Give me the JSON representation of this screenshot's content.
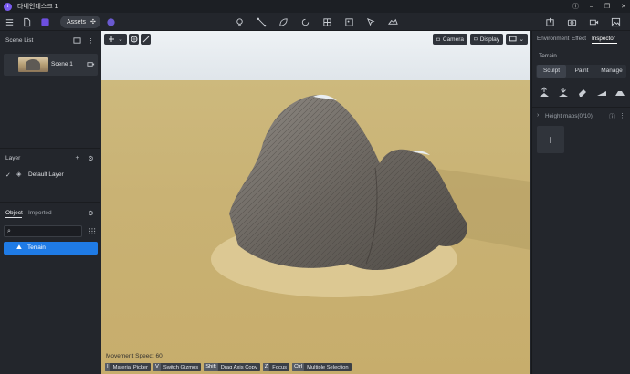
{
  "titlebar": {
    "app_title": "타네인데스크 1",
    "logo_letter": "t"
  },
  "toolbar": {
    "assets_label": "Assets"
  },
  "left": {
    "scene_list_title": "Scene List",
    "scene_name": "Scene 1",
    "layer_title": "Layer",
    "default_layer": "Default Layer",
    "object_tab": "Object",
    "imported_tab": "Imported",
    "terrain_item": "Terrain"
  },
  "viewport": {
    "camera_label": "Camera",
    "display_label": "Display",
    "movement_speed": "Movement Speed: 60",
    "hints": [
      {
        "key": "I",
        "label": "Material Picker"
      },
      {
        "key": "V",
        "label": "Switch Gizmos"
      },
      {
        "key": "Shift",
        "label": "Drag Axis Copy"
      },
      {
        "key": "Z",
        "label": "Focus"
      },
      {
        "key": "Ctrl",
        "label": "Multiple Selection"
      }
    ]
  },
  "right": {
    "tabs": [
      "Environment",
      "Effect",
      "Inspector"
    ],
    "active_tab": "Inspector",
    "section_title": "Terrain",
    "segments": [
      "Sculpt",
      "Paint",
      "Manage"
    ],
    "active_segment": "Sculpt",
    "height_maps_label": "Height maps(0/10)",
    "add_symbol": "+"
  },
  "colors": {
    "accent": "#1f7be6",
    "logo": "#7a5cf0",
    "panel": "#23262c"
  }
}
